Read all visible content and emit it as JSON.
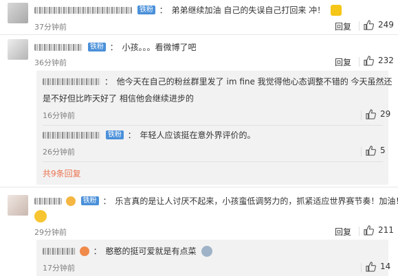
{
  "comments": [
    {
      "text": "弟弟继续加油 自己的失误自己打回来 冲！",
      "badge": "铁粉",
      "time": "37分钟前",
      "reply": "回复",
      "likes": "249"
    },
    {
      "text": "小孩。。。看微博了吧",
      "badge": "铁粉",
      "time": "36分钟前",
      "reply": "回复",
      "likes": "232",
      "subs": [
        {
          "text_line1": "他今天在自己的粉丝群里发了 im fine 我觉得他心态调整不错的 今天虽然还",
          "text_line2": "是不好但比昨天好了 相信他会继续进步的",
          "time": "16分钟前",
          "likes": "29"
        },
        {
          "badge": "铁粉",
          "text": "年轻人应该挺在意外界评价的。",
          "time": "26分钟前",
          "likes": "5"
        }
      ],
      "more": "共9条回复"
    },
    {
      "text": "乐言真的是让人讨厌不起来，小孩蛮低调努力的，抓紧适应世界赛节奏！加油！",
      "badge": "铁粉",
      "time": "29分钟前",
      "reply": "回复",
      "likes": "211",
      "subs": [
        {
          "text": "憨憨的挺可爱就是有点菜",
          "time": "17分钟前",
          "likes": "14"
        }
      ]
    }
  ],
  "icons": {
    "thumb": "thumbs-up-icon",
    "reply": "reply-link"
  },
  "colors": {
    "fan_badge": "#4a90d9",
    "more_link": "#eb7350",
    "sub_bg": "#f2f2f2"
  }
}
